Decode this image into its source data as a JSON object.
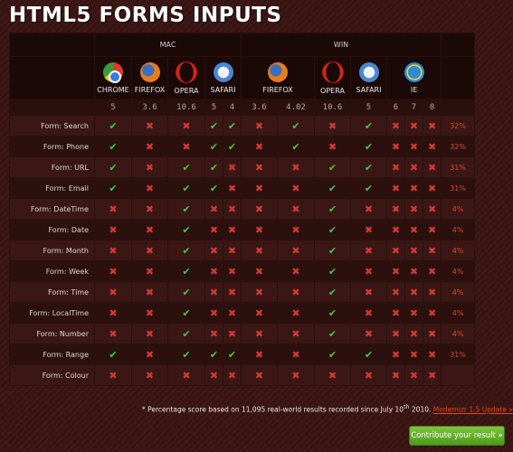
{
  "title": "HTML5 FORMS INPUTS",
  "groups": [
    "MAC",
    "WIN"
  ],
  "browsers": [
    {
      "name": "CHROME",
      "icon": "chrome-icon"
    },
    {
      "name": "FIREFOX",
      "icon": "firefox-icon"
    },
    {
      "name": "OPERA",
      "icon": "opera-icon"
    },
    {
      "name": "SAFARI",
      "icon": "safari-icon"
    },
    {
      "name": "FIREFOX",
      "icon": "firefox-icon"
    },
    {
      "name": "OPERA",
      "icon": "opera-icon"
    },
    {
      "name": "SAFARI",
      "icon": "safari-icon"
    },
    {
      "name": "IE",
      "icon": "ie-icon"
    }
  ],
  "versions": [
    "5",
    "3.6",
    "10.6",
    "5",
    "4",
    "3.6",
    "4.02",
    "10.6",
    "5",
    "6",
    "7",
    "8"
  ],
  "rows": [
    {
      "label": "Form: Search",
      "cells": [
        "yes",
        "no",
        "no",
        "yes",
        "yes",
        "no",
        "yes",
        "no",
        "yes",
        "no",
        "no",
        "no"
      ],
      "score": "32%"
    },
    {
      "label": "Form: Phone",
      "cells": [
        "yes",
        "no",
        "no",
        "yes",
        "yes",
        "no",
        "yes",
        "no",
        "yes",
        "no",
        "no",
        "no"
      ],
      "score": "32%"
    },
    {
      "label": "Form: URL",
      "cells": [
        "yes",
        "no",
        "yes",
        "yes",
        "no",
        "no",
        "no",
        "yes",
        "yes",
        "no",
        "no",
        "no"
      ],
      "score": "31%"
    },
    {
      "label": "Form: Email",
      "cells": [
        "yes",
        "no",
        "yes",
        "yes",
        "no",
        "no",
        "no",
        "yes",
        "yes",
        "no",
        "no",
        "no"
      ],
      "score": "31%"
    },
    {
      "label": "Form: DateTime",
      "cells": [
        "no",
        "no",
        "yes",
        "no",
        "no",
        "no",
        "no",
        "yes",
        "no",
        "no",
        "no",
        "no"
      ],
      "score": "4%"
    },
    {
      "label": "Form: Date",
      "cells": [
        "no",
        "no",
        "yes",
        "no",
        "no",
        "no",
        "no",
        "yes",
        "no",
        "no",
        "no",
        "no"
      ],
      "score": "4%"
    },
    {
      "label": "Form: Month",
      "cells": [
        "no",
        "no",
        "yes",
        "no",
        "no",
        "no",
        "no",
        "yes",
        "no",
        "no",
        "no",
        "no"
      ],
      "score": "4%"
    },
    {
      "label": "Form: Week",
      "cells": [
        "no",
        "no",
        "yes",
        "no",
        "no",
        "no",
        "no",
        "yes",
        "no",
        "no",
        "no",
        "no"
      ],
      "score": "4%"
    },
    {
      "label": "Form: Time",
      "cells": [
        "no",
        "no",
        "yes",
        "no",
        "no",
        "no",
        "no",
        "yes",
        "no",
        "no",
        "no",
        "no"
      ],
      "score": "4%"
    },
    {
      "label": "Form: LocalTime",
      "cells": [
        "no",
        "no",
        "yes",
        "no",
        "no",
        "no",
        "no",
        "yes",
        "no",
        "no",
        "no",
        "no"
      ],
      "score": "4%"
    },
    {
      "label": "Form: Number",
      "cells": [
        "no",
        "no",
        "yes",
        "no",
        "no",
        "no",
        "no",
        "yes",
        "no",
        "no",
        "no",
        "no"
      ],
      "score": "4%"
    },
    {
      "label": "Form: Range",
      "cells": [
        "yes",
        "no",
        "yes",
        "yes",
        "yes",
        "no",
        "no",
        "yes",
        "yes",
        "no",
        "no",
        "no"
      ],
      "score": "31%"
    },
    {
      "label": "Form: Colour",
      "cells": [
        "no",
        "no",
        "no",
        "no",
        "no",
        "no",
        "no",
        "no",
        "no",
        "no",
        "no",
        "no"
      ],
      "score": ""
    }
  ],
  "symbols": {
    "yes": "✔",
    "no": "✖"
  },
  "footer": {
    "note_prefix": "* Percentage score based on 11,095 real-world results recorded since July 10",
    "note_sup": "th",
    "note_suffix": " 2010.",
    "link": "Modernizr 1.5 Update »"
  },
  "contribute_button": "Contribute your result »",
  "colors": {
    "yes": "#48c64a",
    "no": "#d13b34",
    "score": "#e04a1e",
    "button": "#5fae25"
  }
}
